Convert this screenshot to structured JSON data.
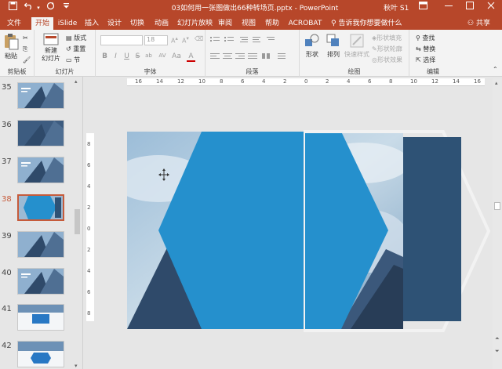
{
  "titlebar": {
    "title": "03如何用一张图做出66种转场页.pptx - PowerPoint",
    "user": "秋叶 S1",
    "quick": [
      "save-icon",
      "undo-icon",
      "redo-icon",
      "customize-icon"
    ],
    "win": [
      "ribbon-options-icon",
      "minimize-icon",
      "restore-icon",
      "close-icon"
    ]
  },
  "tabs": [
    "文件",
    "开始",
    "iSlide",
    "插入",
    "设计",
    "切换",
    "动画",
    "幻灯片放映",
    "审阅",
    "视图",
    "帮助",
    "ACROBAT"
  ],
  "tabs_active": "开始",
  "tellme": "告诉我你想要做什么",
  "share": "共享",
  "ribbon": {
    "clipboard": {
      "label": "剪贴板",
      "paste": "粘贴"
    },
    "slides": {
      "label": "幻灯片",
      "new_slide": "新建\n幻灯片",
      "layout": "版式",
      "reset": "重置",
      "section": "节"
    },
    "font": {
      "label": "字体",
      "size": "18",
      "format_buttons": [
        "B",
        "I",
        "U",
        "S",
        "ab",
        "AV",
        "Aa",
        "A"
      ]
    },
    "paragraph": {
      "label": "段落"
    },
    "drawing": {
      "label": "绘图",
      "shapes": "形状",
      "arrange": "排列",
      "quick_styles": "快速样式",
      "fill": "形状填充",
      "outline": "形状轮廓",
      "effects": "形状效果"
    },
    "editing": {
      "label": "编辑",
      "find": "查找",
      "replace": "替换",
      "select": "选择"
    }
  },
  "slides": [
    {
      "num": "35",
      "style": "building-text"
    },
    {
      "num": "36",
      "style": "building-dark"
    },
    {
      "num": "37",
      "style": "building-text"
    },
    {
      "num": "38",
      "style": "hexagon",
      "selected": true
    },
    {
      "num": "39",
      "style": "building"
    },
    {
      "num": "40",
      "style": "building-text"
    },
    {
      "num": "41",
      "style": "white-blue-box"
    },
    {
      "num": "42",
      "style": "white-blue-hex"
    }
  ],
  "ruler_top": [
    "16",
    "14",
    "12",
    "10",
    "8",
    "6",
    "4",
    "2",
    "0",
    "2",
    "4",
    "6",
    "8",
    "10",
    "12",
    "14",
    "16"
  ],
  "ruler_left": [
    "8",
    "6",
    "4",
    "2",
    "0",
    "2",
    "4",
    "6",
    "8"
  ],
  "colors": {
    "accent": "#b7472a",
    "hexagon": "#2590cd",
    "navy": "#2e5275",
    "thumb_select": "#c65b3b"
  }
}
